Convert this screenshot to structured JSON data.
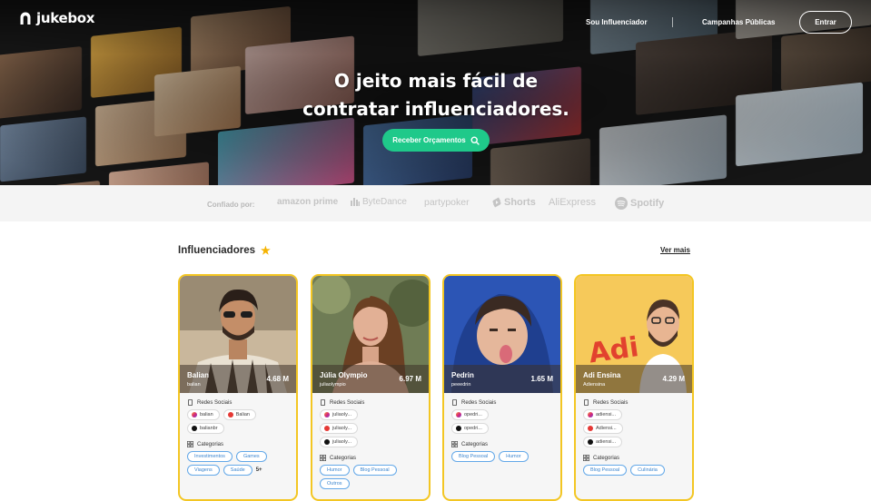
{
  "brand": {
    "name": "jukebox"
  },
  "nav": {
    "influencer_link": "Sou Influenciador",
    "campaigns_link": "Campanhas Públicas",
    "login_button": "Entrar"
  },
  "hero": {
    "headline_line1": "O jeito mais fácil de",
    "headline_line2": "contratar influenciadores.",
    "cta_label": "Receber Orçamentos",
    "cta_icon": "search-icon"
  },
  "trusted": {
    "label": "Confiado por:",
    "brands": [
      "amazon prime",
      "ByteDance",
      "partypoker",
      "Shorts",
      "AliExpress",
      "Spotify"
    ]
  },
  "section": {
    "title": "Influenciadores",
    "see_more": "Ver mais"
  },
  "labels": {
    "socials": "Redes Sociais",
    "categories": "Categorias"
  },
  "cards": [
    {
      "name": "Balian",
      "handle": "balian",
      "followers": "4.68 M",
      "socials": [
        {
          "label": "balian",
          "network": "instagram"
        },
        {
          "label": "Balian",
          "network": "youtube"
        },
        {
          "label": "balianbr",
          "network": "tiktok"
        }
      ],
      "categories": [
        "Investimentos",
        "Games",
        "Viagens",
        "Saúde"
      ],
      "more": "5+"
    },
    {
      "name": "Júlia Olympio",
      "handle": "juliaolympio",
      "followers": "6.97 M",
      "socials": [
        {
          "label": "juliaoly...",
          "network": "instagram"
        },
        {
          "label": "juliaoly...",
          "network": "youtube"
        },
        {
          "label": "juliaoly...",
          "network": "tiktok"
        }
      ],
      "categories": [
        "Humor",
        "Blog Pessoal",
        "Outros"
      ]
    },
    {
      "name": "Pedrin",
      "handle": "peeedrin",
      "followers": "1.65 M",
      "socials": [
        {
          "label": "opedri...",
          "network": "instagram"
        },
        {
          "label": "opedri...",
          "network": "tiktok"
        }
      ],
      "categories": [
        "Blog Pessoal",
        "Humor"
      ]
    },
    {
      "name": "Adi Ensina",
      "handle": "Adiensina",
      "followers": "4.29 M",
      "socials": [
        {
          "label": "adiensi...",
          "network": "instagram"
        },
        {
          "label": "Adiensi...",
          "network": "youtube"
        },
        {
          "label": "adiensi...",
          "network": "tiktok"
        }
      ],
      "categories": [
        "Blog Pessoal",
        "Culinária"
      ]
    }
  ],
  "colors": {
    "accent_green": "#1fc98a",
    "card_border": "#f3c623",
    "tag_blue": "#3d86cf",
    "star": "#f5b301"
  }
}
